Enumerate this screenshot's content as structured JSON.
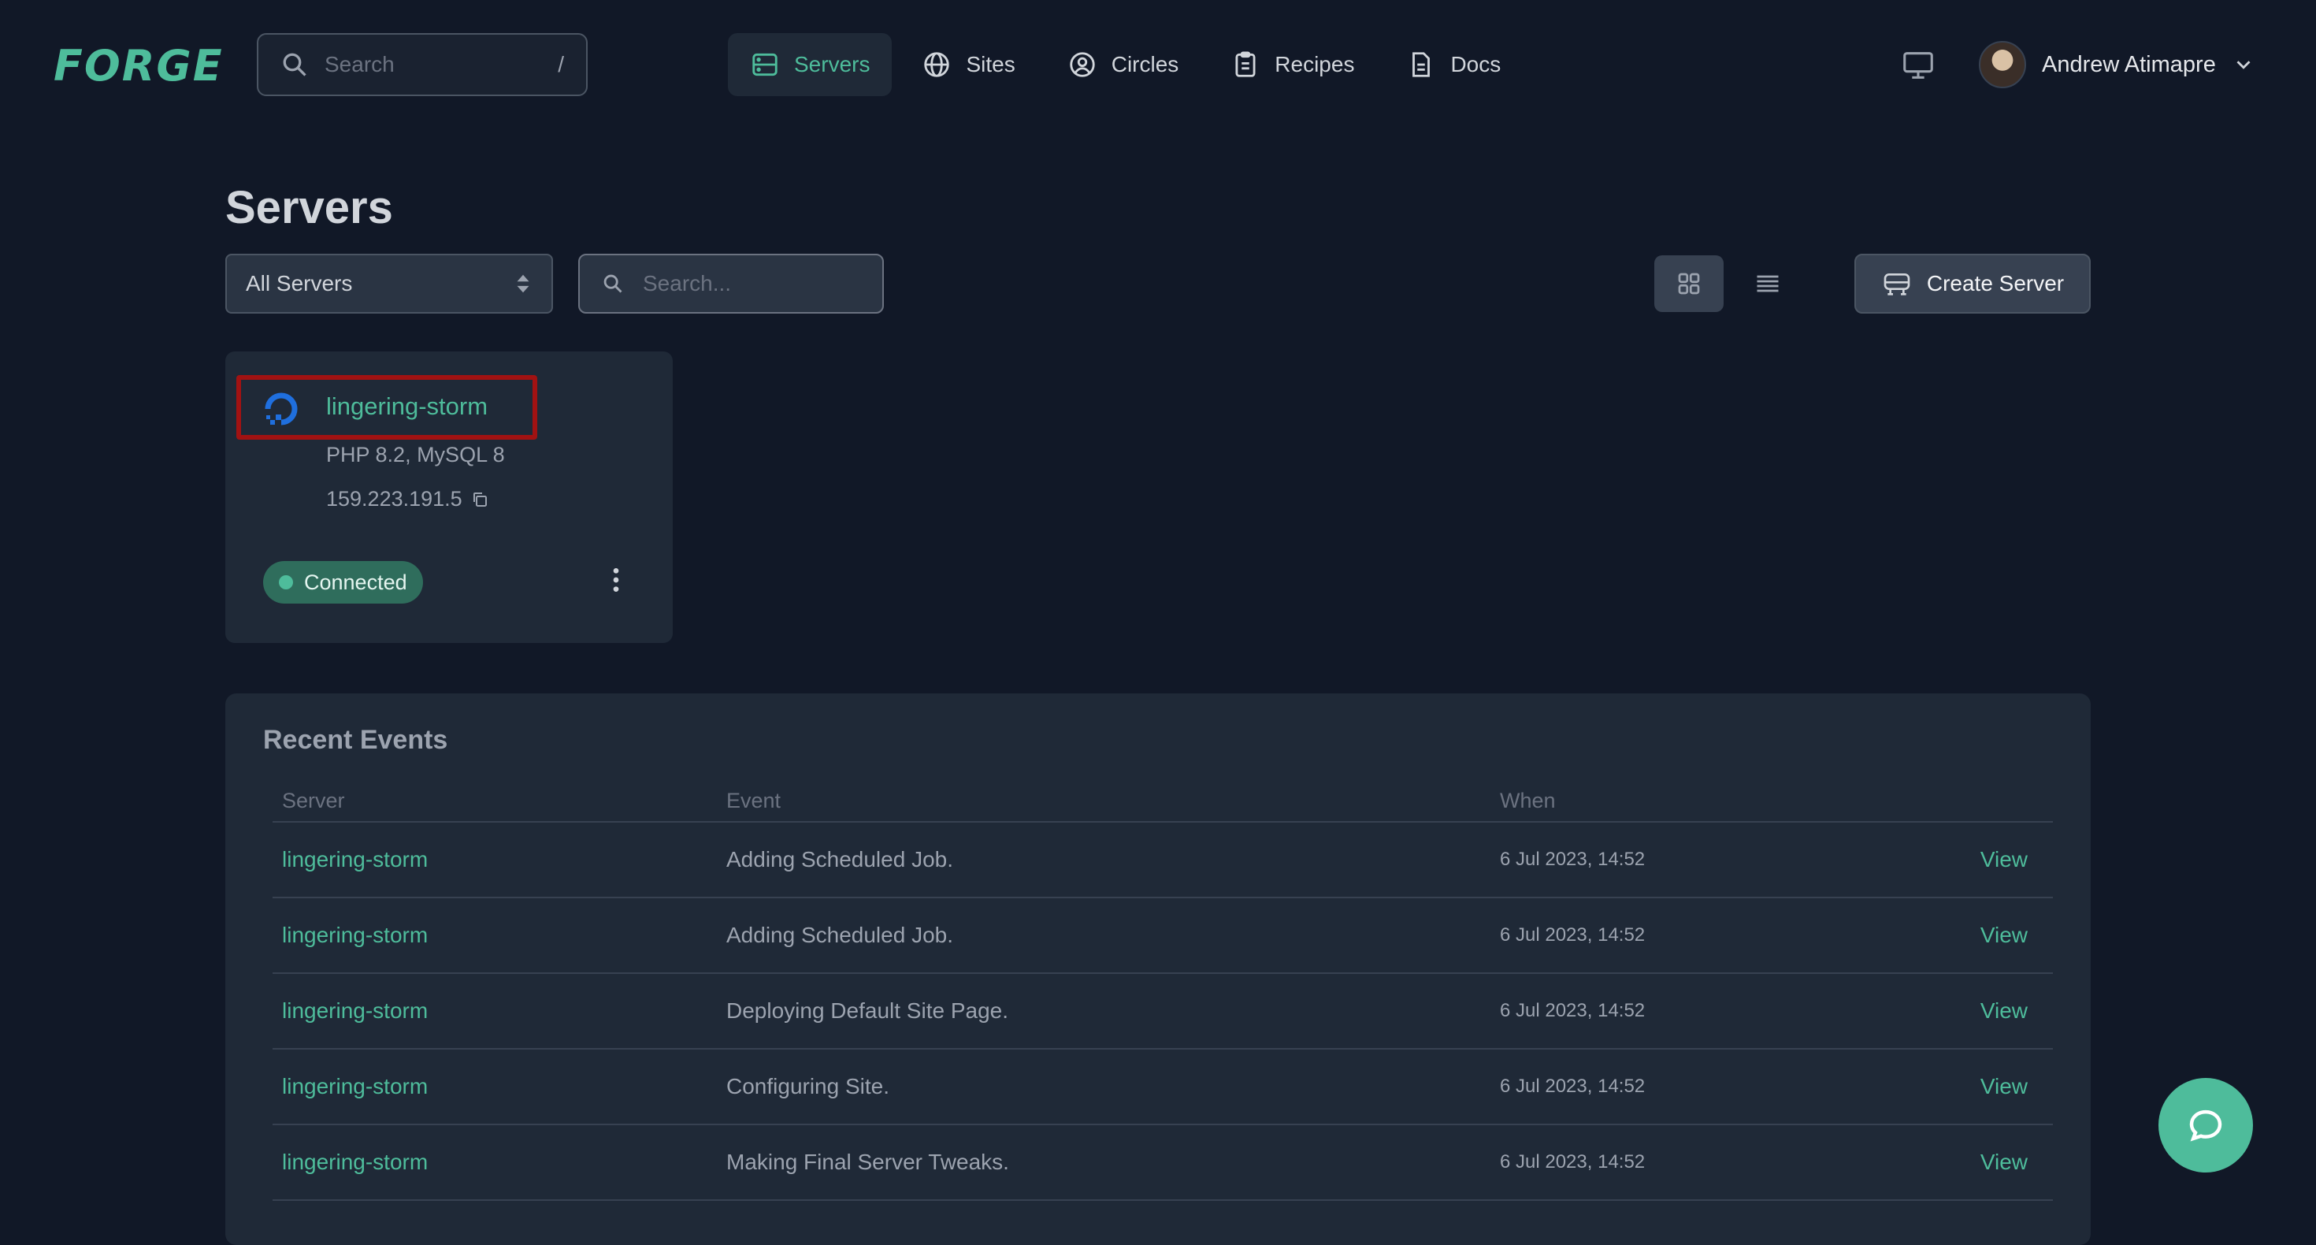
{
  "brand": {
    "logo_text": "FORGE",
    "accent": "#4ebc9b"
  },
  "top_search": {
    "placeholder": "Search",
    "shortcut": "/"
  },
  "nav": {
    "items": [
      {
        "label": "Servers",
        "icon": "server-icon",
        "active": true
      },
      {
        "label": "Sites",
        "icon": "globe-icon",
        "active": false
      },
      {
        "label": "Circles",
        "icon": "user-circle-icon",
        "active": false
      },
      {
        "label": "Recipes",
        "icon": "clipboard-icon",
        "active": false
      },
      {
        "label": "Docs",
        "icon": "document-icon",
        "active": false
      }
    ]
  },
  "user": {
    "name": "Andrew Atimapre"
  },
  "page": {
    "title": "Servers",
    "filter_select": "All Servers",
    "filter_search_placeholder": "Search...",
    "create_button": "Create Server"
  },
  "server_card": {
    "name": "lingering-storm",
    "stack": "PHP 8.2, MySQL 8",
    "ip": "159.223.191.5",
    "status": "Connected",
    "provider_icon": "digitalocean-icon"
  },
  "events": {
    "title": "Recent Events",
    "columns": {
      "server": "Server",
      "event": "Event",
      "when": "When"
    },
    "rows": [
      {
        "server": "lingering-storm",
        "event": "Adding Scheduled Job.",
        "when": "6 Jul 2023, 14:52",
        "action": "View"
      },
      {
        "server": "lingering-storm",
        "event": "Adding Scheduled Job.",
        "when": "6 Jul 2023, 14:52",
        "action": "View"
      },
      {
        "server": "lingering-storm",
        "event": "Deploying Default Site Page.",
        "when": "6 Jul 2023, 14:52",
        "action": "View"
      },
      {
        "server": "lingering-storm",
        "event": "Configuring Site.",
        "when": "6 Jul 2023, 14:52",
        "action": "View"
      },
      {
        "server": "lingering-storm",
        "event": "Making Final Server Tweaks.",
        "when": "6 Jul 2023, 14:52",
        "action": "View"
      }
    ]
  }
}
